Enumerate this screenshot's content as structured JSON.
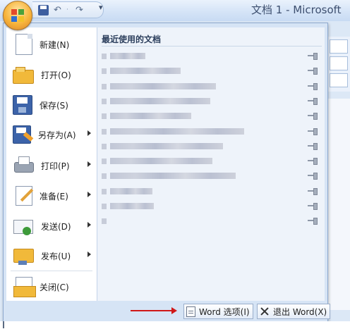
{
  "window": {
    "title": "文档 1 - Microsoft"
  },
  "quick_access": {
    "icons": [
      "save-icon",
      "undo-icon",
      "redo-icon",
      "customize-qat-icon"
    ],
    "undo_glyph": "↶",
    "redo_glyph": "↷",
    "separator_glyph": "·",
    "more_glyph": "▾"
  },
  "menu": {
    "items": [
      {
        "id": "new",
        "label": "新建(N)",
        "icon": "new-document-icon",
        "has_submenu": false
      },
      {
        "id": "open",
        "label": "打开(O)",
        "icon": "open-folder-icon",
        "has_submenu": false
      },
      {
        "id": "save",
        "label": "保存(S)",
        "icon": "save-disk-icon",
        "has_submenu": false
      },
      {
        "id": "saveas",
        "label": "另存为(A)",
        "icon": "save-as-icon",
        "has_submenu": true
      },
      {
        "id": "print",
        "label": "打印(P)",
        "icon": "printer-icon",
        "has_submenu": true
      },
      {
        "id": "prepare",
        "label": "准备(E)",
        "icon": "prepare-document-icon",
        "has_submenu": true
      },
      {
        "id": "send",
        "label": "发送(D)",
        "icon": "send-icon",
        "has_submenu": true
      },
      {
        "id": "publish",
        "label": "发布(U)",
        "icon": "publish-icon",
        "has_submenu": true
      },
      {
        "id": "close",
        "label": "关闭(C)",
        "icon": "close-document-icon",
        "has_submenu": false
      }
    ]
  },
  "recent": {
    "title": "最近使用的文档",
    "rows": 12,
    "pin_icon": "pushpin-icon"
  },
  "bottom": {
    "options_label": "Word 选项(I)",
    "exit_label": "退出 Word(X)",
    "annotation_color": "#d01818"
  },
  "colors": {
    "menu_bg": "#d6e4f5",
    "accent_orange": "#f7b43b"
  }
}
